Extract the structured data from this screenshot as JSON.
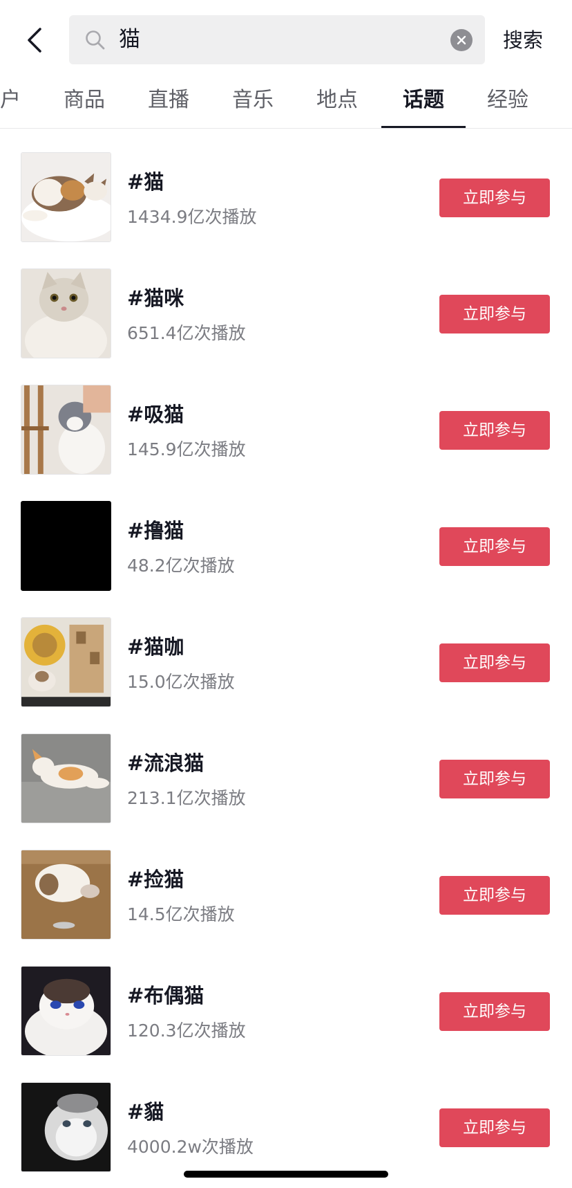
{
  "search": {
    "query": "猫",
    "submit_label": "搜索"
  },
  "tabs": [
    {
      "label": "户",
      "active": false
    },
    {
      "label": "商品",
      "active": false
    },
    {
      "label": "直播",
      "active": false
    },
    {
      "label": "音乐",
      "active": false
    },
    {
      "label": "地点",
      "active": false
    },
    {
      "label": "话题",
      "active": true
    },
    {
      "label": "经验",
      "active": false
    }
  ],
  "topics": [
    {
      "title": "#猫",
      "plays": "1434.9亿次播放",
      "button": "立即参与",
      "thumb": "cat-lying-white-bed"
    },
    {
      "title": "#猫咪",
      "plays": "651.4亿次播放",
      "button": "立即参与",
      "thumb": "british-shorthair-cream"
    },
    {
      "title": "#吸猫",
      "plays": "145.9亿次播放",
      "button": "立即参与",
      "thumb": "grey-white-cat-petting"
    },
    {
      "title": "#撸猫",
      "plays": "48.2亿次播放",
      "button": "立即参与",
      "thumb": "black-thumbnail"
    },
    {
      "title": "#猫咖",
      "plays": "15.0亿次播放",
      "button": "立即参与",
      "thumb": "cat-cafe-scratcher"
    },
    {
      "title": "#流浪猫",
      "plays": "213.1亿次播放",
      "button": "立即参与",
      "thumb": "stray-cat-on-pavement"
    },
    {
      "title": "#捡猫",
      "plays": "14.5亿次播放",
      "button": "立即参与",
      "thumb": "kitten-on-wood-floor"
    },
    {
      "title": "#布偶猫",
      "plays": "120.3亿次播放",
      "button": "立即参与",
      "thumb": "ragdoll-cat"
    },
    {
      "title": "#貓",
      "plays": "4000.2w次播放",
      "button": "立即参与",
      "thumb": "grey-cat-dark-bg"
    }
  ],
  "colors": {
    "accent": "#e0485a",
    "text_primary": "#161823",
    "text_secondary": "#7b7c82",
    "search_bg": "#efeff0"
  }
}
